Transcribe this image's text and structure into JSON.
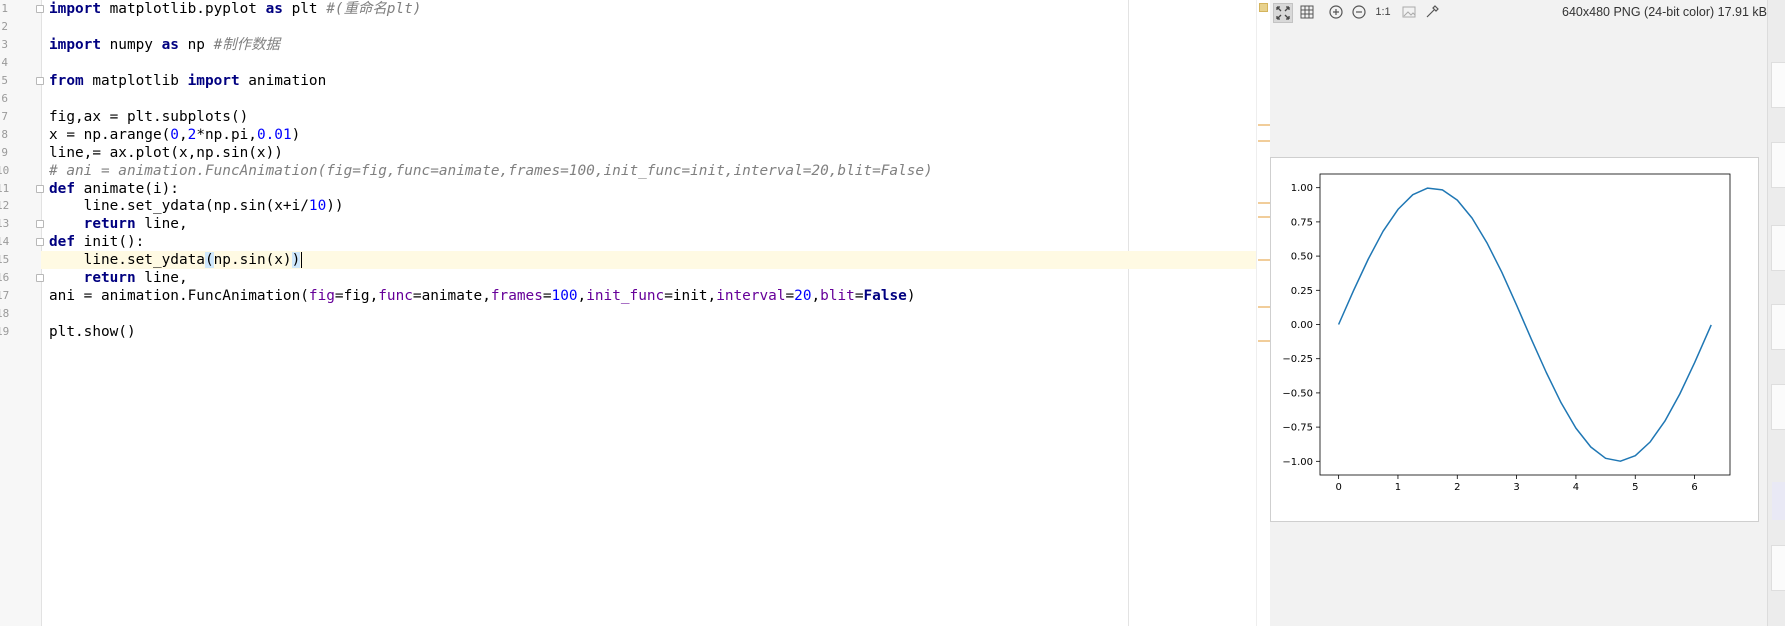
{
  "editor": {
    "lines": [
      {
        "num": "1",
        "fold": true,
        "tokens": [
          {
            "t": "import",
            "c": "kw"
          },
          {
            "t": " matplotlib.pyplot "
          },
          {
            "t": "as",
            "c": "kw"
          },
          {
            "t": " plt "
          },
          {
            "t": "#(重命名plt)",
            "c": "cm"
          }
        ]
      },
      {
        "num": "2",
        "fold": false,
        "tokens": []
      },
      {
        "num": "3",
        "fold": false,
        "tokens": [
          {
            "t": "import",
            "c": "kw"
          },
          {
            "t": " numpy "
          },
          {
            "t": "as",
            "c": "kw"
          },
          {
            "t": " np "
          },
          {
            "t": "#制作数据",
            "c": "cm"
          }
        ]
      },
      {
        "num": "4",
        "fold": false,
        "tokens": []
      },
      {
        "num": "5",
        "fold": true,
        "tokens": [
          {
            "t": "from",
            "c": "kw"
          },
          {
            "t": " matplotlib "
          },
          {
            "t": "import",
            "c": "kw"
          },
          {
            "t": " animation"
          }
        ]
      },
      {
        "num": "6",
        "fold": false,
        "tokens": []
      },
      {
        "num": "7",
        "fold": false,
        "tokens": [
          {
            "t": "fig,ax = plt.subplots()"
          }
        ]
      },
      {
        "num": "8",
        "fold": false,
        "tokens": [
          {
            "t": "x = np.arange("
          },
          {
            "t": "0",
            "c": "num"
          },
          {
            "t": ","
          },
          {
            "t": "2",
            "c": "num"
          },
          {
            "t": "*np.pi,"
          },
          {
            "t": "0.01",
            "c": "num"
          },
          {
            "t": ")"
          }
        ]
      },
      {
        "num": "9",
        "fold": false,
        "tokens": [
          {
            "t": "line,= ax.plot(x,np.sin(x))"
          }
        ]
      },
      {
        "num": "10",
        "fold": false,
        "tokens": [
          {
            "t": "# ani = animation.FuncAnimation(fig=fig,func=animate,frames=100,init_func=init,interval=20,blit=False)",
            "c": "cm"
          }
        ]
      },
      {
        "num": "11",
        "fold": true,
        "tokens": [
          {
            "t": "def",
            "c": "kw"
          },
          {
            "t": " animate(i):"
          }
        ]
      },
      {
        "num": "12",
        "fold": false,
        "tokens": [
          {
            "t": "    line.set_ydata(np.sin(x+i/"
          },
          {
            "t": "10",
            "c": "num"
          },
          {
            "t": "))"
          }
        ]
      },
      {
        "num": "13",
        "fold": true,
        "tokens": [
          {
            "t": "    "
          },
          {
            "t": "return",
            "c": "kw"
          },
          {
            "t": " line,"
          }
        ]
      },
      {
        "num": "14",
        "fold": true,
        "tokens": [
          {
            "t": "def",
            "c": "kw"
          },
          {
            "t": " init():"
          }
        ]
      },
      {
        "num": "15",
        "fold": false,
        "current": true,
        "tokens": [
          {
            "t": "    line.set_ydata"
          },
          {
            "t": "(",
            "c": "brk"
          },
          {
            "t": "np.sin(x)"
          },
          {
            "t": ")",
            "c": "brk"
          }
        ]
      },
      {
        "num": "16",
        "fold": true,
        "tokens": [
          {
            "t": "    "
          },
          {
            "t": "return",
            "c": "kw"
          },
          {
            "t": " line,"
          }
        ]
      },
      {
        "num": "17",
        "fold": false,
        "tokens": [
          {
            "t": "ani = animation.FuncAnimation("
          },
          {
            "t": "fig",
            "c": "prm"
          },
          {
            "t": "=fig,"
          },
          {
            "t": "func",
            "c": "prm"
          },
          {
            "t": "=animate,"
          },
          {
            "t": "frames",
            "c": "prm"
          },
          {
            "t": "="
          },
          {
            "t": "100",
            "c": "num"
          },
          {
            "t": ","
          },
          {
            "t": "init_func",
            "c": "prm"
          },
          {
            "t": "=init,"
          },
          {
            "t": "interval",
            "c": "prm"
          },
          {
            "t": "="
          },
          {
            "t": "20",
            "c": "num"
          },
          {
            "t": ","
          },
          {
            "t": "blit",
            "c": "prm"
          },
          {
            "t": "="
          },
          {
            "t": "False",
            "c": "kw"
          },
          {
            "t": ")"
          }
        ]
      },
      {
        "num": "18",
        "fold": false,
        "tokens": []
      },
      {
        "num": "19",
        "fold": false,
        "tokens": [
          {
            "t": "plt.show()"
          }
        ]
      }
    ]
  },
  "viewer": {
    "info": "640x480 PNG (24-bit color) 17.91 kB",
    "toolbar": [
      {
        "name": "fit-icon",
        "active": true
      },
      {
        "name": "grid-icon",
        "active": false
      },
      {
        "name": "zoom-in-icon",
        "active": false
      },
      {
        "name": "zoom-out-icon",
        "active": false
      },
      {
        "name": "actual-size-button",
        "label": "1:1",
        "active": false
      },
      {
        "name": "image-icon",
        "active": false
      },
      {
        "name": "color-picker-icon",
        "active": false
      }
    ]
  },
  "chart_data": {
    "type": "line",
    "title": "",
    "xlabel": "",
    "ylabel": "",
    "xlim": [
      -0.314,
      6.597
    ],
    "ylim": [
      -1.1,
      1.1
    ],
    "xticks": [
      0,
      1,
      2,
      3,
      4,
      5,
      6
    ],
    "xtick_labels": [
      "0",
      "1",
      "2",
      "3",
      "4",
      "5",
      "6"
    ],
    "yticks": [
      -1.0,
      -0.75,
      -0.5,
      -0.25,
      0.0,
      0.25,
      0.5,
      0.75,
      1.0
    ],
    "ytick_labels": [
      "−1.00",
      "−0.75",
      "−0.50",
      "−0.25",
      "0.00",
      "0.25",
      "0.50",
      "0.75",
      "1.00"
    ],
    "grid": false,
    "series": [
      {
        "color": "#1f77b4",
        "x": [
          0,
          0.25,
          0.5,
          0.75,
          1.0,
          1.25,
          1.5,
          1.75,
          2.0,
          2.25,
          2.5,
          2.75,
          3.0,
          3.25,
          3.5,
          3.75,
          4.0,
          4.25,
          4.5,
          4.75,
          5.0,
          5.25,
          5.5,
          5.75,
          6.0,
          6.28
        ],
        "y": [
          0.0,
          0.247,
          0.479,
          0.682,
          0.841,
          0.949,
          0.997,
          0.984,
          0.909,
          0.778,
          0.598,
          0.382,
          0.141,
          -0.108,
          -0.351,
          -0.572,
          -0.757,
          -0.895,
          -0.978,
          -0.999,
          -0.959,
          -0.859,
          -0.706,
          -0.508,
          -0.279,
          -0.003
        ]
      }
    ]
  }
}
